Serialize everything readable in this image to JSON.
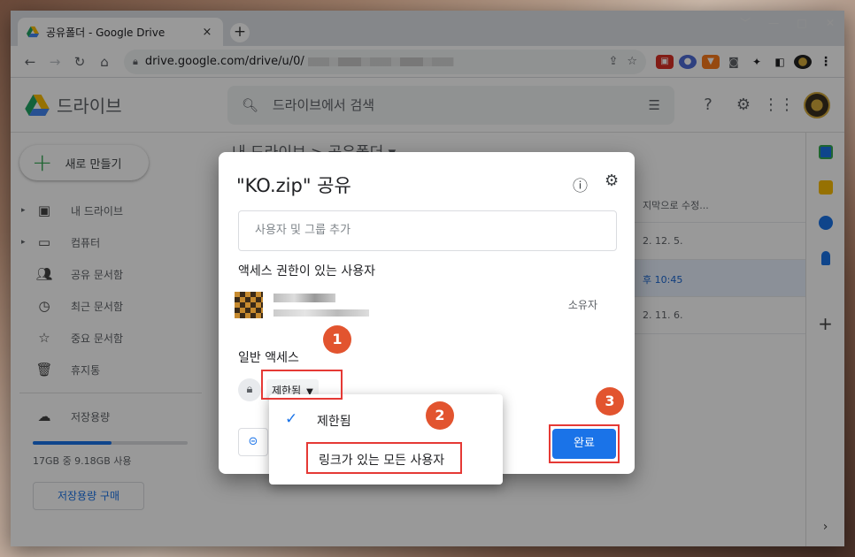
{
  "browser": {
    "tab_title": "공유폴더 - Google Drive",
    "tab_close": "×",
    "new_tab": "+",
    "url": "drive.google.com/drive/u/0/",
    "window_controls": [
      "﹀",
      "—",
      "□",
      "✕"
    ]
  },
  "drive": {
    "app_name": "드라이브",
    "search_placeholder": "드라이브에서 검색",
    "new_button": "새로 만들기",
    "nav": [
      {
        "label": "내 드라이브",
        "icon": "my-drive-icon"
      },
      {
        "label": "컴퓨터",
        "icon": "computer-icon"
      },
      {
        "label": "공유 문서함",
        "icon": "shared-icon"
      },
      {
        "label": "최근 문서함",
        "icon": "clock-icon"
      },
      {
        "label": "중요 문서함",
        "icon": "star-icon"
      },
      {
        "label": "휴지통",
        "icon": "trash-icon"
      }
    ],
    "storage_label": "저장용량",
    "storage_used_fraction": 0.51,
    "storage_text": "17GB 중 9.18GB 사용",
    "buy_storage": "저장용량 구매",
    "breadcrumb": "내 드라이브  >  공유폴더 ▾",
    "rows": [
      {
        "when": "지막으로 수정..."
      },
      {
        "when": "2. 12. 5."
      },
      {
        "when": "후 10:45"
      },
      {
        "when": "2. 11. 6."
      }
    ]
  },
  "dialog": {
    "title": "\"KO.zip\" 공유",
    "add_placeholder": "사용자 및 그룹 추가",
    "people_heading": "액세스 권한이 있는 사용자",
    "owner_label": "소유자",
    "general_heading": "일반 액세스",
    "restricted_value": "제한됨",
    "done_button": "완료"
  },
  "dropdown": {
    "options": [
      "제한됨",
      "링크가 있는 모든 사용자"
    ],
    "selected": "제한됨"
  },
  "annotations": [
    "1",
    "2",
    "3"
  ],
  "colors": {
    "accent": "#1a73e8",
    "annotation": "#e53935",
    "badge": "#e2542f"
  }
}
